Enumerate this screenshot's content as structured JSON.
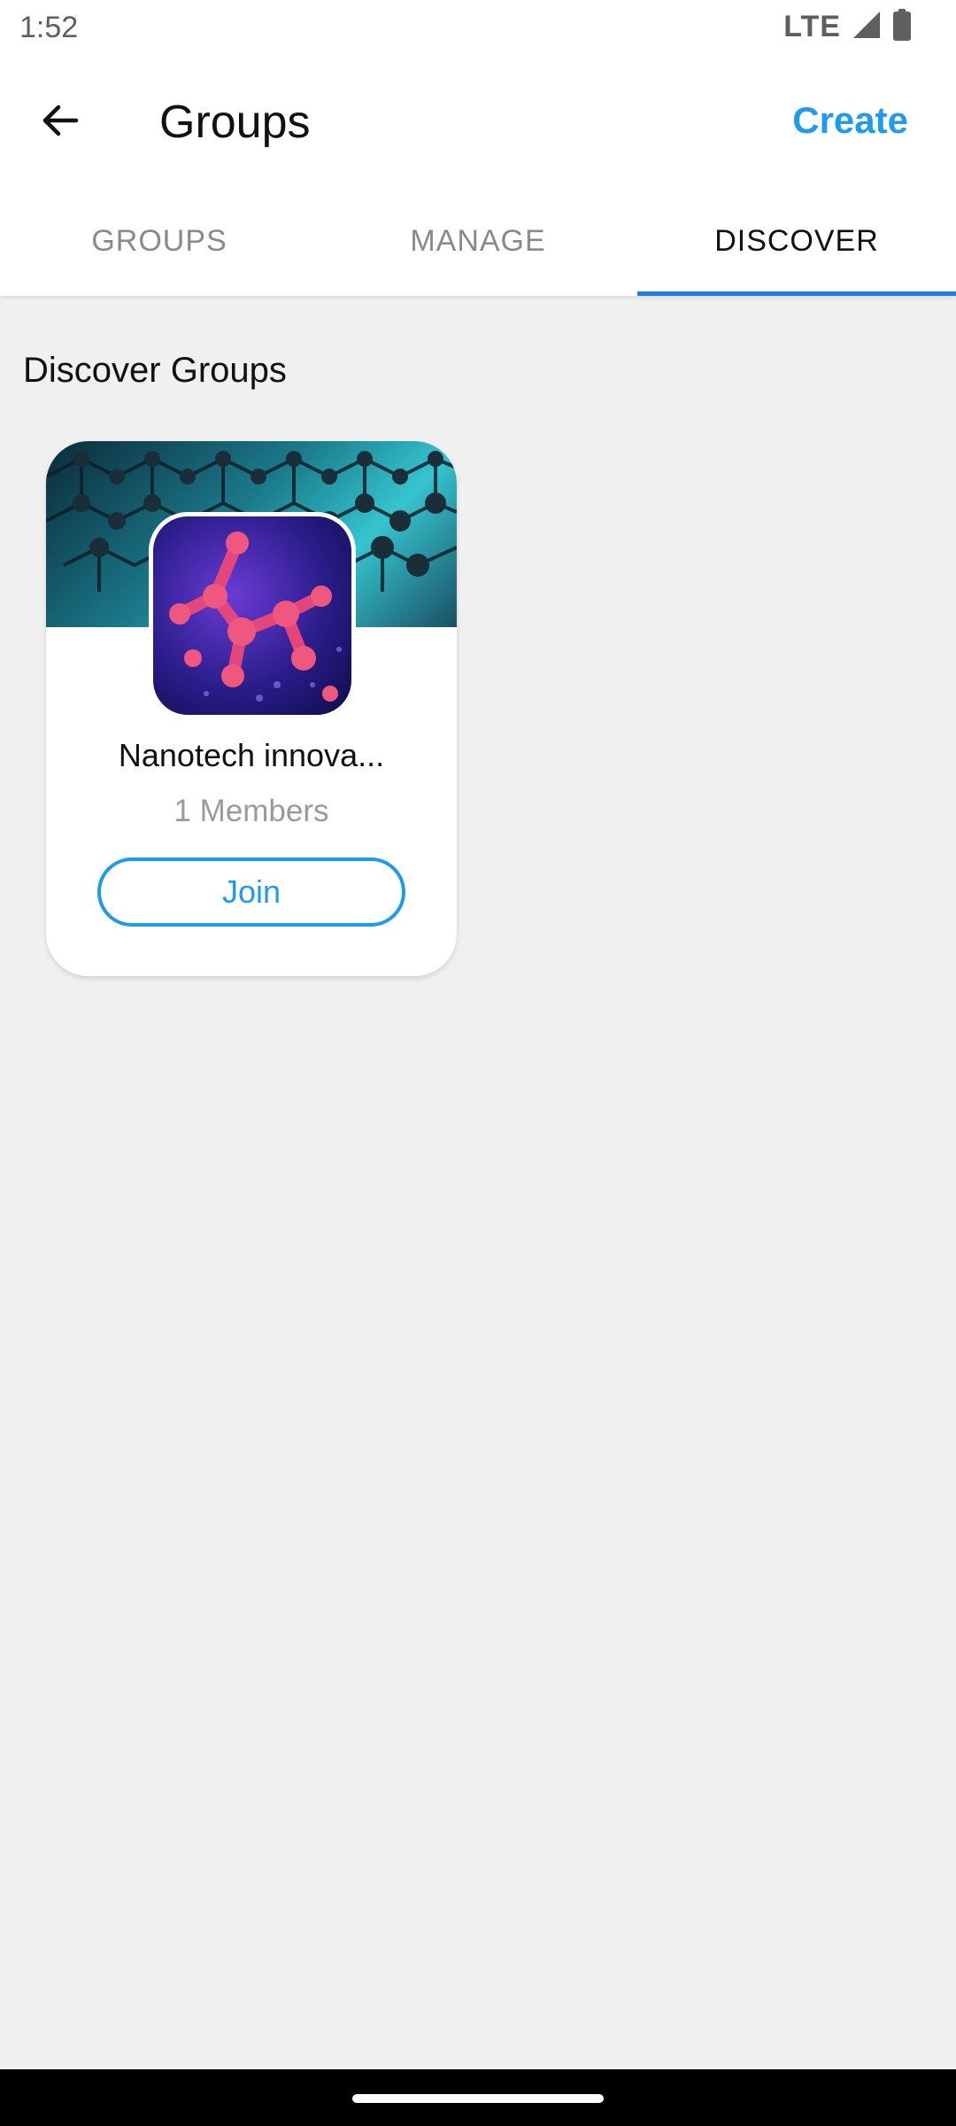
{
  "status_bar": {
    "time": "1:52",
    "network": "LTE",
    "icons": [
      "signal-icon",
      "battery-icon"
    ]
  },
  "app_bar": {
    "back_icon": "arrow-left-icon",
    "title": "Groups",
    "create_label": "Create"
  },
  "tabs": [
    {
      "label": "GROUPS",
      "active": false
    },
    {
      "label": "MANAGE",
      "active": false
    },
    {
      "label": "DISCOVER",
      "active": true
    }
  ],
  "section": {
    "title": "Discover Groups"
  },
  "groups": [
    {
      "name": "Nanotech innova...",
      "members": "1 Members",
      "join_label": "Join"
    }
  ],
  "colors": {
    "accent": "#1e9bea",
    "tab_indicator": "#1e7fe0",
    "background": "#f0f0f0"
  }
}
